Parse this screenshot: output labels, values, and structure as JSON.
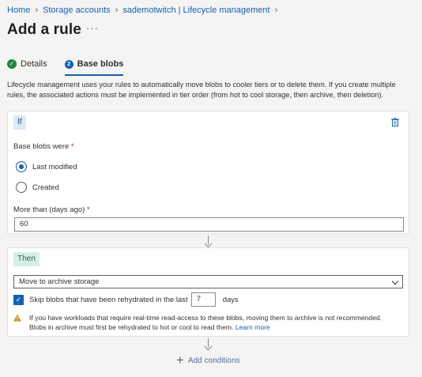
{
  "breadcrumb": {
    "items": [
      "Home",
      "Storage accounts",
      "sademotwitch | Lifecycle management"
    ]
  },
  "header": {
    "title": "Add a rule",
    "more": "···"
  },
  "tabs": [
    {
      "label": "Details",
      "state": "completed"
    },
    {
      "label": "Base blobs",
      "number": "2",
      "state": "active"
    }
  ],
  "description": "Lifecycle management uses your rules to automatically move blobs to cooler tiers or to delete them. If you create multiple rules, the associated actions must be implemented in tier order (from hot to cool storage, then archive, then deletion).",
  "if_block": {
    "badge": "If",
    "base_blobs_label": "Base blobs were",
    "required_mark": "*",
    "options": [
      {
        "label": "Last modified",
        "selected": true
      },
      {
        "label": "Created",
        "selected": false
      }
    ],
    "days_label": "More than (days ago)",
    "days_value": "60"
  },
  "then_block": {
    "badge": "Then",
    "action_selected": "Move to archive storage",
    "skip_label": "Skip blobs that have been rehydrated in the last",
    "skip_checked": true,
    "skip_days": "7",
    "skip_unit": "days",
    "warning_text": "If you have workloads that require real-time read-access to these blobs, moving them to archive is not recommended. Blobs in archive must first be rehydrated to hot or cool to read them.",
    "warning_link": "Learn more"
  },
  "add_conditions": {
    "label": "Add conditions"
  },
  "colors": {
    "accent": "#0f62b8",
    "success": "#1a8a3c",
    "warning": "#d18e12"
  }
}
